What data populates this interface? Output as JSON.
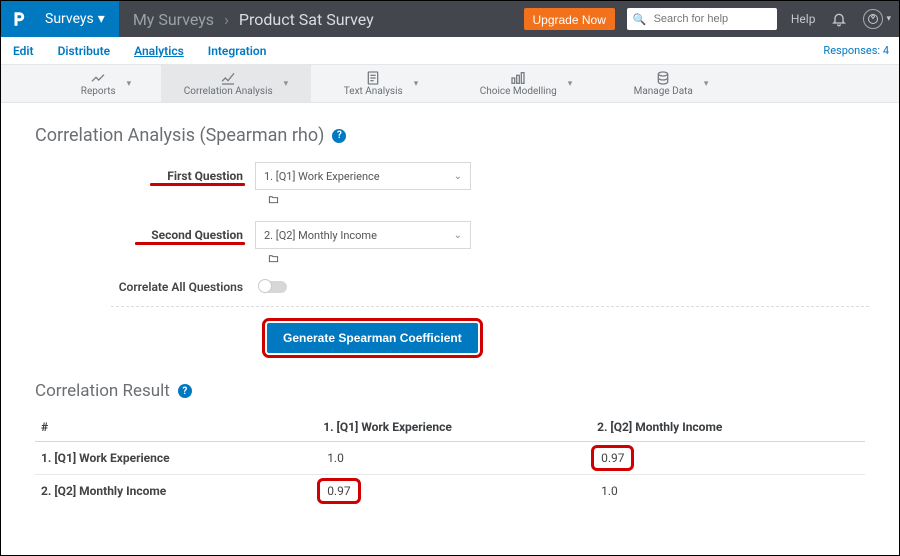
{
  "top": {
    "surveys_label": "Surveys",
    "breadcrumb_root": "My Surveys",
    "breadcrumb_sep": "›",
    "survey_title": "Product Sat Survey",
    "upgrade_label": "Upgrade Now",
    "search_placeholder": "Search for help",
    "help_label": "Help"
  },
  "nav": {
    "tabs": [
      "Edit",
      "Distribute",
      "Analytics",
      "Integration"
    ],
    "active_index": 2,
    "responses_label": "Responses: 4"
  },
  "toolbar": {
    "items": [
      "Reports",
      "Correlation Analysis",
      "Text Analysis",
      "Choice Modelling",
      "Manage Data"
    ],
    "active_index": 1
  },
  "panel": {
    "title": "Correlation Analysis (Spearman rho)",
    "first_label": "First Question",
    "second_label": "Second Question",
    "first_value": "1. [Q1] Work Experience",
    "second_value": "2. [Q2] Monthly Income",
    "toggle_label": "Correlate All Questions",
    "generate_label": "Generate Spearman Coefficient"
  },
  "result": {
    "title": "Correlation Result",
    "headers": [
      "#",
      "1. [Q1] Work Experience",
      "2. [Q2] Monthly Income"
    ],
    "rows": [
      {
        "label": "1. [Q1] Work Experience",
        "c1": "1.0",
        "c2": "0.97"
      },
      {
        "label": "2. [Q2] Monthly Income",
        "c1": "0.97",
        "c2": "1.0"
      }
    ]
  }
}
